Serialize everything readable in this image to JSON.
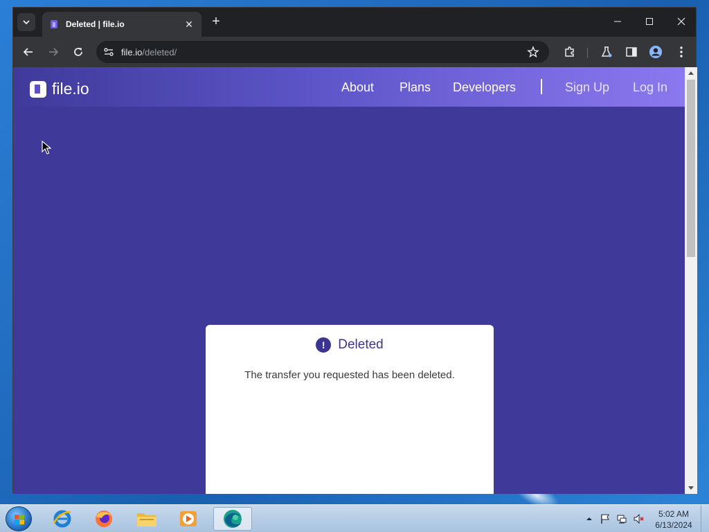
{
  "browser": {
    "tab_title": "Deleted | file.io",
    "tab_close": "✕",
    "new_tab": "+",
    "url_host": "file.io",
    "url_path": "/deleted/"
  },
  "site": {
    "logo_text": "file.io",
    "nav": {
      "about": "About",
      "plans": "Plans",
      "developers": "Developers",
      "sign_up": "Sign Up",
      "log_in": "Log In"
    },
    "card": {
      "icon_glyph": "!",
      "title": "Deleted",
      "message": "The transfer you requested has been deleted."
    }
  },
  "taskbar": {
    "time": "5:02 AM",
    "date": "6/13/2024"
  },
  "colors": {
    "page_bg": "#3f3a9a",
    "header_gradient_end": "#8b78ee",
    "accent": "#3b3590",
    "browser_dark": "#202124",
    "browser_toolbar": "#35363a"
  }
}
